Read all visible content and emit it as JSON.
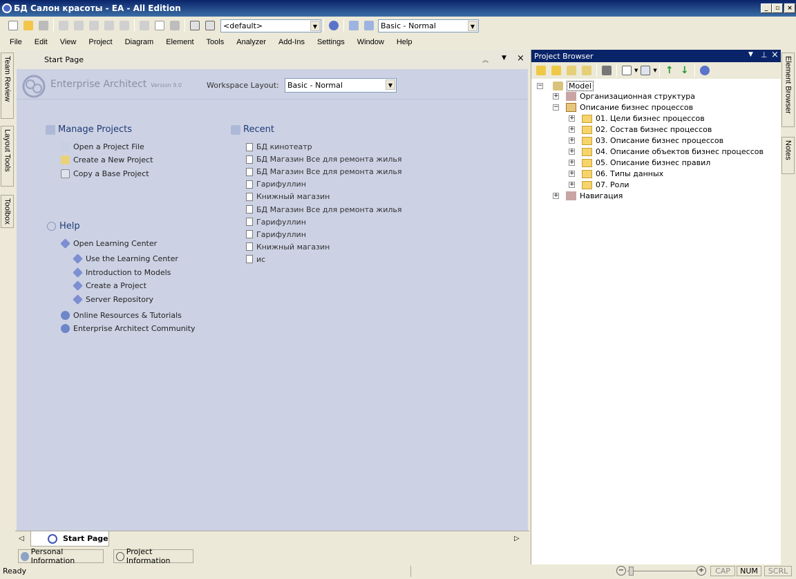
{
  "window": {
    "title": "БД Салон красоты - EA - All Edition"
  },
  "toolbar": {
    "diagram_combo": "<default>",
    "layout_combo": "Basic - Normal"
  },
  "menu": [
    "File",
    "Edit",
    "View",
    "Project",
    "Diagram",
    "Element",
    "Tools",
    "Analyzer",
    "Add-Ins",
    "Settings",
    "Window",
    "Help"
  ],
  "left_tabs": [
    "Team Review",
    "Layout Tools",
    "Toolbox"
  ],
  "start_page": {
    "header": "Start Page",
    "product": "Enterprise Architect",
    "version": "Version 9.0",
    "workspace_label": "Workspace Layout:",
    "workspace_value": "Basic - Normal",
    "manage_title": "Manage Projects",
    "manage_links": [
      "Open a Project File",
      "Create a New Project",
      "Copy a Base Project"
    ],
    "help_title": "Help",
    "learning": "Open Learning Center",
    "help_sub": [
      "Use the Learning Center",
      "Introduction to Models",
      "Create a Project",
      "Server Repository"
    ],
    "online": "Online Resources & Tutorials",
    "community": "Enterprise Architect Community",
    "recent_title": "Recent",
    "recent": [
      "БД кинотеатр",
      "БД Магазин Все для ремонта жилья",
      "БД Магазин Все для ремонта жилья",
      "Гарифуллин",
      "Книжный магазин",
      "БД Магазин Все для ремонта жилья",
      "Гарифуллин",
      "Гарифуллин",
      "Книжный магазин",
      "ис"
    ],
    "tab_label": "Start Page"
  },
  "bottom_tabs": [
    "Personal Information",
    "Project Information"
  ],
  "status": {
    "text": "Ready",
    "cap": "CAP",
    "num": "NUM",
    "scrl": "SCRL"
  },
  "project_browser": {
    "title": "Project Browser",
    "root": "Model",
    "nodes": [
      {
        "label": "Организационная структура"
      },
      {
        "label": "Описание бизнес процессов"
      },
      {
        "label": "01. Цели бизнес процессов"
      },
      {
        "label": "02. Состав бизнес процессов"
      },
      {
        "label": "03. Описание бизнес процессов"
      },
      {
        "label": "04. Описание объектов бизнес процессов"
      },
      {
        "label": "05. Описание бизнес правил"
      },
      {
        "label": "06. Типы данных"
      },
      {
        "label": "07. Роли"
      },
      {
        "label": "Навигация"
      }
    ]
  },
  "right_tabs": [
    "Element Browser",
    "Notes"
  ]
}
